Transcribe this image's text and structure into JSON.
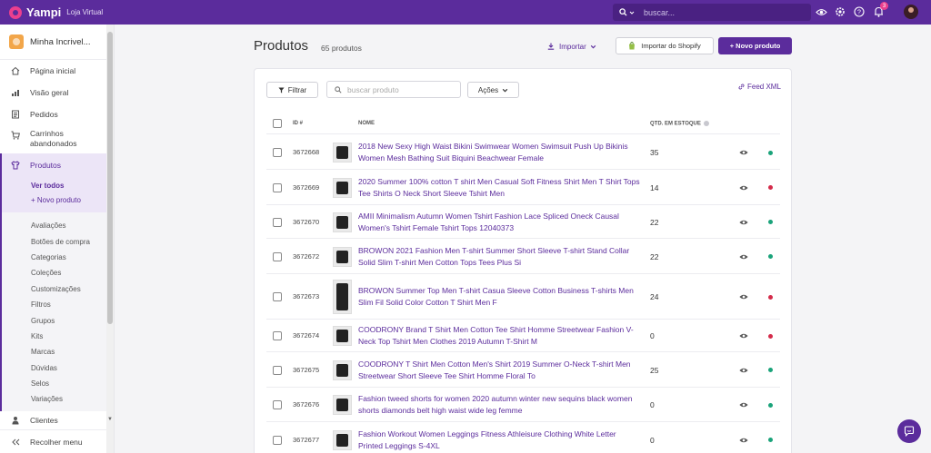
{
  "topbar": {
    "brand_name": "Yampi",
    "brand_sub": "Loja Virtual",
    "search_placeholder": "buscar...",
    "notification_count": "3",
    "icons": [
      "search-icon",
      "eye-icon",
      "gear-icon",
      "help-icon",
      "bell-icon"
    ]
  },
  "sidebar": {
    "store_name": "Minha Incrivel...",
    "nav": [
      {
        "label": "Página inicial",
        "icon": "home-icon"
      },
      {
        "label": "Visão geral",
        "icon": "chart-icon"
      },
      {
        "label": "Pedidos",
        "icon": "orders-icon"
      },
      {
        "label": "Carrinhos abandonados",
        "icon": "cart-icon"
      }
    ],
    "active": {
      "label": "Produtos",
      "icon": "shirt-icon"
    },
    "sub": [
      "Ver todos",
      "+ Novo produto"
    ],
    "sub2": [
      "Avaliações",
      "Botões de compra",
      "Categorias",
      "Coleções",
      "Customizações",
      "Filtros",
      "Grupos",
      "Kits",
      "Marcas",
      "Dúvidas",
      "Selos",
      "Variações"
    ],
    "clients": {
      "label": "Clientes",
      "icon": "user-icon"
    },
    "collapse": "Recolher menu"
  },
  "header": {
    "title": "Produtos",
    "count": "65 produtos",
    "import_label": "Importar",
    "shopify_label": "Importar do Shopify",
    "new_label": "+ Novo produto"
  },
  "toolbar": {
    "filter_label": "Filtrar",
    "search_placeholder": "buscar produto",
    "actions_label": "Ações",
    "feed_label": "Feed XML"
  },
  "table": {
    "columns": {
      "id": "ID #",
      "name": "NOME",
      "qty": "QTD. EM ESTOQUE"
    },
    "rows": [
      {
        "id": "3672668",
        "name": "2018 New Sexy High Waist Bikini Swimwear Women Swimsuit Push Up Bikinis Women Mesh Bathing Suit Biquini Beachwear Female",
        "qty": "35",
        "status": "#1aa37a"
      },
      {
        "id": "3672669",
        "name": "2020 Summer 100% cotton T shirt Men Casual Soft Fitness Shirt Men T Shirt Tops Tee Shirts O Neck Short Sleeve Tshirt Men",
        "qty": "14",
        "status": "#d42b4a"
      },
      {
        "id": "3672670",
        "name": "AMII Minimalism Autumn Women Tshirt Fashion Lace Spliced Oneck Causal Women's Tshirt Female Tshirt Tops 12040373",
        "qty": "22",
        "status": "#1aa37a"
      },
      {
        "id": "3672672",
        "name": "BROWON 2021 Fashion Men T-shirt Summer Short Sleeve T-shirt Stand Collar Solid Slim T-shirt Men Cotton Tops Tees Plus Si",
        "qty": "22",
        "status": "#1aa37a"
      },
      {
        "id": "3672673",
        "name": "BROWON Summer Top Men T-shirt Casua Sleeve Cotton Business T-shirts Men Slim Fil Solid Color Cotton T Shirt Men F",
        "qty": "24",
        "status": "#d42b4a"
      },
      {
        "id": "3672674",
        "name": "COODRONY Brand T Shirt Men Cotton Tee Shirt Homme Streetwear Fashion V-Neck Top Tshirt Men Clothes 2019 Autumn T-Shirt M",
        "qty": "0",
        "status": "#d42b4a"
      },
      {
        "id": "3672675",
        "name": "COODRONY T Shirt Men Cotton Men's Shirt 2019 Summer O-Neck T-shirt Men Streetwear Short Sleeve Tee Shirt Homme Floral To",
        "qty": "25",
        "status": "#1aa37a"
      },
      {
        "id": "3672676",
        "name": "Fashion tweed shorts for women 2020 autumn winter new sequins black women shorts diamonds belt high waist wide leg femme",
        "qty": "0",
        "status": "#1aa37a"
      },
      {
        "id": "3672677",
        "name": "Fashion Workout Women Leggings Fitness Athleisure Clothing White Letter Printed Leggings S-4XL",
        "qty": "0",
        "status": "#1aa37a"
      }
    ]
  },
  "colors": {
    "accent": "#5b2c9c",
    "success": "#1aa37a",
    "danger": "#d42b4a"
  }
}
